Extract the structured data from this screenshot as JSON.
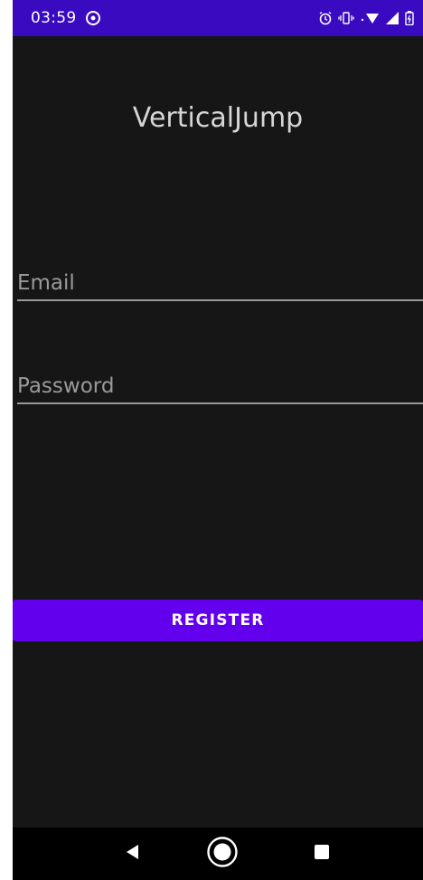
{
  "status_bar": {
    "time": "03:59",
    "left_icon": "sync-icon",
    "right_icons": [
      "alarm-icon",
      "vibrate-icon",
      "wifi-icon",
      "signal-icon",
      "battery-icon"
    ],
    "color": "#3a0ac0"
  },
  "app": {
    "title": "VerticalJump"
  },
  "form": {
    "email": {
      "placeholder": "Email",
      "value": ""
    },
    "password": {
      "placeholder": "Password",
      "value": ""
    },
    "register_label": "REGISTER",
    "accent": "#6200ee"
  },
  "nav_bar": {
    "buttons": [
      "back-icon",
      "home-icon",
      "recents-icon"
    ]
  }
}
